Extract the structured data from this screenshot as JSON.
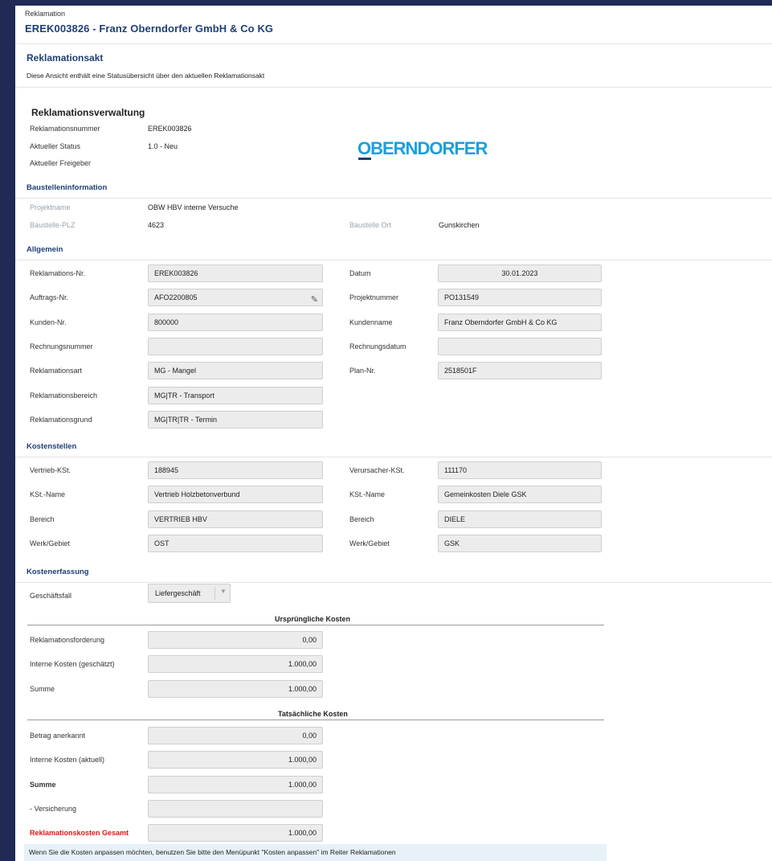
{
  "header": {
    "breadcrumb": "Reklamation",
    "title": "EREK003826 - Franz Oberndorfer GmbH & Co KG"
  },
  "section": {
    "title": "Reklamationsakt",
    "description": "Diese Ansicht enthält eine Statusübersicht über den aktuellen Reklamationsakt"
  },
  "management": {
    "title": "Reklamationsverwaltung",
    "number_label": "Reklamationsnummer",
    "number_value": "EREK003826",
    "status_label": "Aktueller Status",
    "status_value": "1.0 - Neu",
    "approver_label": "Aktueller Freigeber",
    "approver_value": "",
    "logo_text": "OBERNDORFER"
  },
  "site": {
    "title": "Baustelleninformation",
    "project_label": "Projektname",
    "project_value": "OBW HBV interne Versuche",
    "zip_label": "Baustelle-PLZ",
    "zip_value": "4623",
    "city_label": "Baustelle Ort",
    "city_value": "Gunskirchen"
  },
  "general": {
    "title": "Allgemein",
    "left": [
      {
        "label": "Reklamations-Nr.",
        "value": "EREK003826"
      },
      {
        "label": "Auftrags-Nr.",
        "value": "AFO2200805"
      },
      {
        "label": "Kunden-Nr.",
        "value": "800000"
      },
      {
        "label": "Rechnungsnummer",
        "value": ""
      },
      {
        "label": "Reklamationsart",
        "value": "MG - Mangel"
      },
      {
        "label": "Reklamationsbereich",
        "value": "MG|TR - Transport"
      },
      {
        "label": "Reklamationsgrund",
        "value": "MG|TR|TR - Termin"
      }
    ],
    "right": [
      {
        "label": "Datum",
        "value": "30.01.2023"
      },
      {
        "label": "Projektnummer",
        "value": "PO131549"
      },
      {
        "label": "Kundenname",
        "value": "Franz Oberndorfer GmbH & Co KG"
      },
      {
        "label": "Rechnungsdatum",
        "value": ""
      },
      {
        "label": "Plan-Nr.",
        "value": "2518501F"
      }
    ]
  },
  "cost_centers": {
    "title": "Kostenstellen",
    "left": [
      {
        "label": "Vertrieb-KSt.",
        "value": "188945"
      },
      {
        "label": "KSt.-Name",
        "value": "Vertrieb Holzbetonverbund"
      },
      {
        "label": "Bereich",
        "value": "VERTRIEB HBV"
      },
      {
        "label": "Werk/Gebiet",
        "value": "OST"
      }
    ],
    "right": [
      {
        "label": "Verursacher-KSt.",
        "value": "111170"
      },
      {
        "label": "KSt.-Name",
        "value": "Gemeinkosten Diele GSK"
      },
      {
        "label": "Bereich",
        "value": "DIELE"
      },
      {
        "label": "Werk/Gebiet",
        "value": "GSK"
      }
    ]
  },
  "costs": {
    "title": "Kostenerfassung",
    "case_label": "Geschäftsfall",
    "case_value": "Liefergeschäft",
    "original_title": "Ursprüngliche Kosten",
    "original": [
      {
        "label": "Reklamationsforderung",
        "value": "0,00"
      },
      {
        "label": "Interne Kosten (geschätzt)",
        "value": "1.000,00"
      },
      {
        "label": "Summe",
        "value": "1.000,00"
      }
    ],
    "actual_title": "Tatsächliche Kosten",
    "actual": [
      {
        "label": "Betrag anerkannt",
        "value": "0,00"
      },
      {
        "label": "Interne Kosten (aktuell)",
        "value": "1.000,00"
      },
      {
        "label": "Summe",
        "value": "1.000,00"
      },
      {
        "label": "- Versicherung",
        "value": ""
      },
      {
        "label": "Reklamationskosten Gesamt",
        "value": "1.000,00"
      }
    ],
    "note": "Wenn Sie die Kosten anpassen möchten, benutzen Sie bitte den Menüpunkt \"Kosten anpassen\" im Reiter Reklamationen"
  },
  "colors": {
    "accent": "#1f3f73",
    "logo": "#1aa0dd",
    "total_red": "#e0141b",
    "background": "#1f2a55"
  }
}
